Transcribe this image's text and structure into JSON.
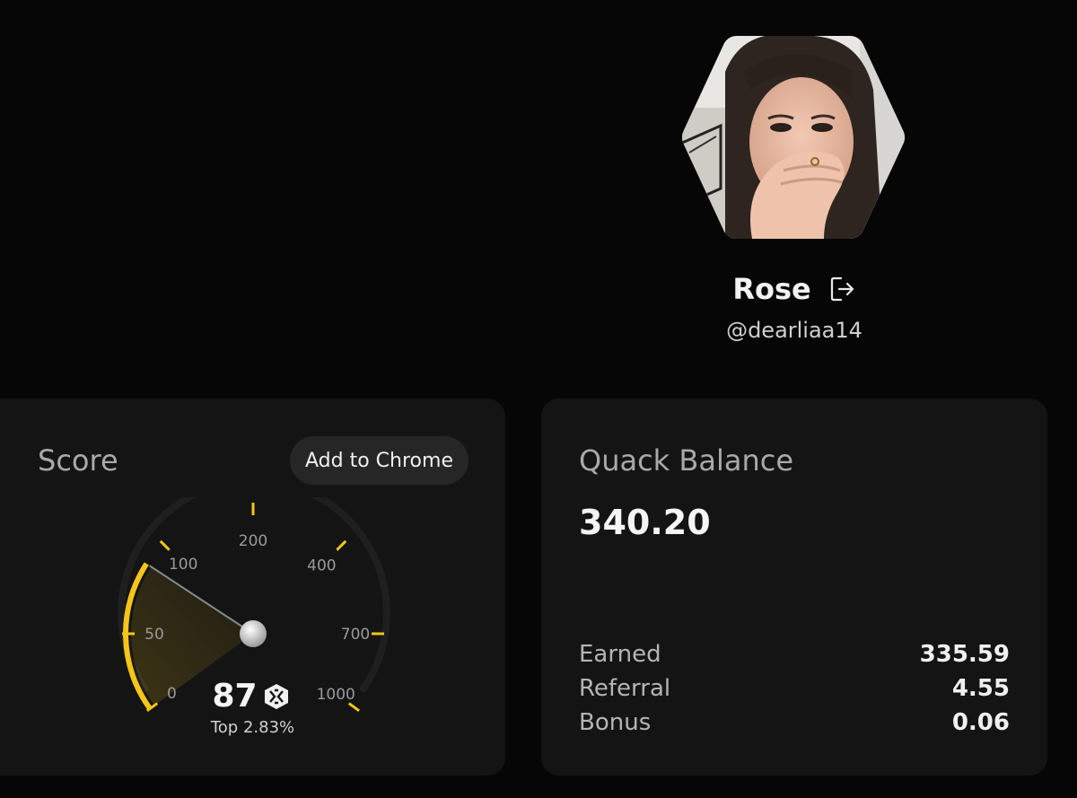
{
  "profile": {
    "name": "Rose",
    "handle": "@dearliaa14"
  },
  "score_card": {
    "title": "Score",
    "add_to_chrome_label": "Add to Chrome",
    "score": "87",
    "rank_text": "Top 2.83%",
    "gauge": {
      "tick_labels": [
        "0",
        "50",
        "100",
        "200",
        "400",
        "700",
        "1000"
      ],
      "value": 87,
      "accent_color": "#f5c518"
    }
  },
  "balance_card": {
    "title": "Quack Balance",
    "total": "340.20",
    "rows": [
      {
        "label": "Earned",
        "value": "335.59"
      },
      {
        "label": "Referral",
        "value": "4.55"
      },
      {
        "label": "Bonus",
        "value": "0.06"
      }
    ]
  },
  "colors": {
    "background": "#060606",
    "card": "#141414",
    "accent": "#f5c518"
  }
}
